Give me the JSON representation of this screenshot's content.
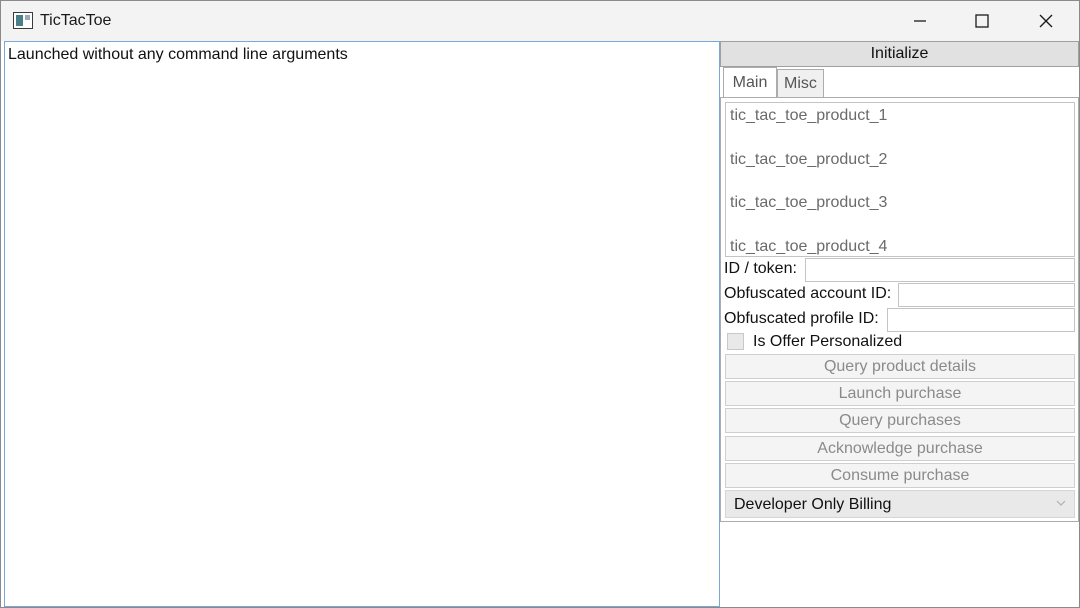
{
  "window": {
    "title": "TicTacToe",
    "controls": {
      "minimize": "minimize-icon",
      "maximize": "maximize-icon",
      "close": "close-icon"
    }
  },
  "log": {
    "text": "Launched without any command line arguments"
  },
  "side": {
    "initialize_label": "Initialize",
    "tabs": [
      {
        "label": "Main",
        "selected": true
      },
      {
        "label": "Misc",
        "selected": false
      }
    ],
    "products": [
      "tic_tac_toe_product_1",
      "tic_tac_toe_product_2",
      "tic_tac_toe_product_3",
      "tic_tac_toe_product_4"
    ],
    "fields": {
      "id_token": {
        "label": "ID / token:",
        "value": ""
      },
      "obfuscated_account_id": {
        "label": "Obfuscated account ID:",
        "value": ""
      },
      "obfuscated_profile_id": {
        "label": "Obfuscated profile ID:",
        "value": ""
      }
    },
    "offer_personalized": {
      "label": "Is Offer Personalized",
      "checked": false
    },
    "buttons": {
      "query_product_details": "Query product details",
      "launch_purchase": "Launch purchase",
      "query_purchases": "Query purchases",
      "acknowledge_purchase": "Acknowledge purchase",
      "consume_purchase": "Consume purchase"
    },
    "billing_mode": {
      "selected": "Developer Only Billing"
    }
  }
}
